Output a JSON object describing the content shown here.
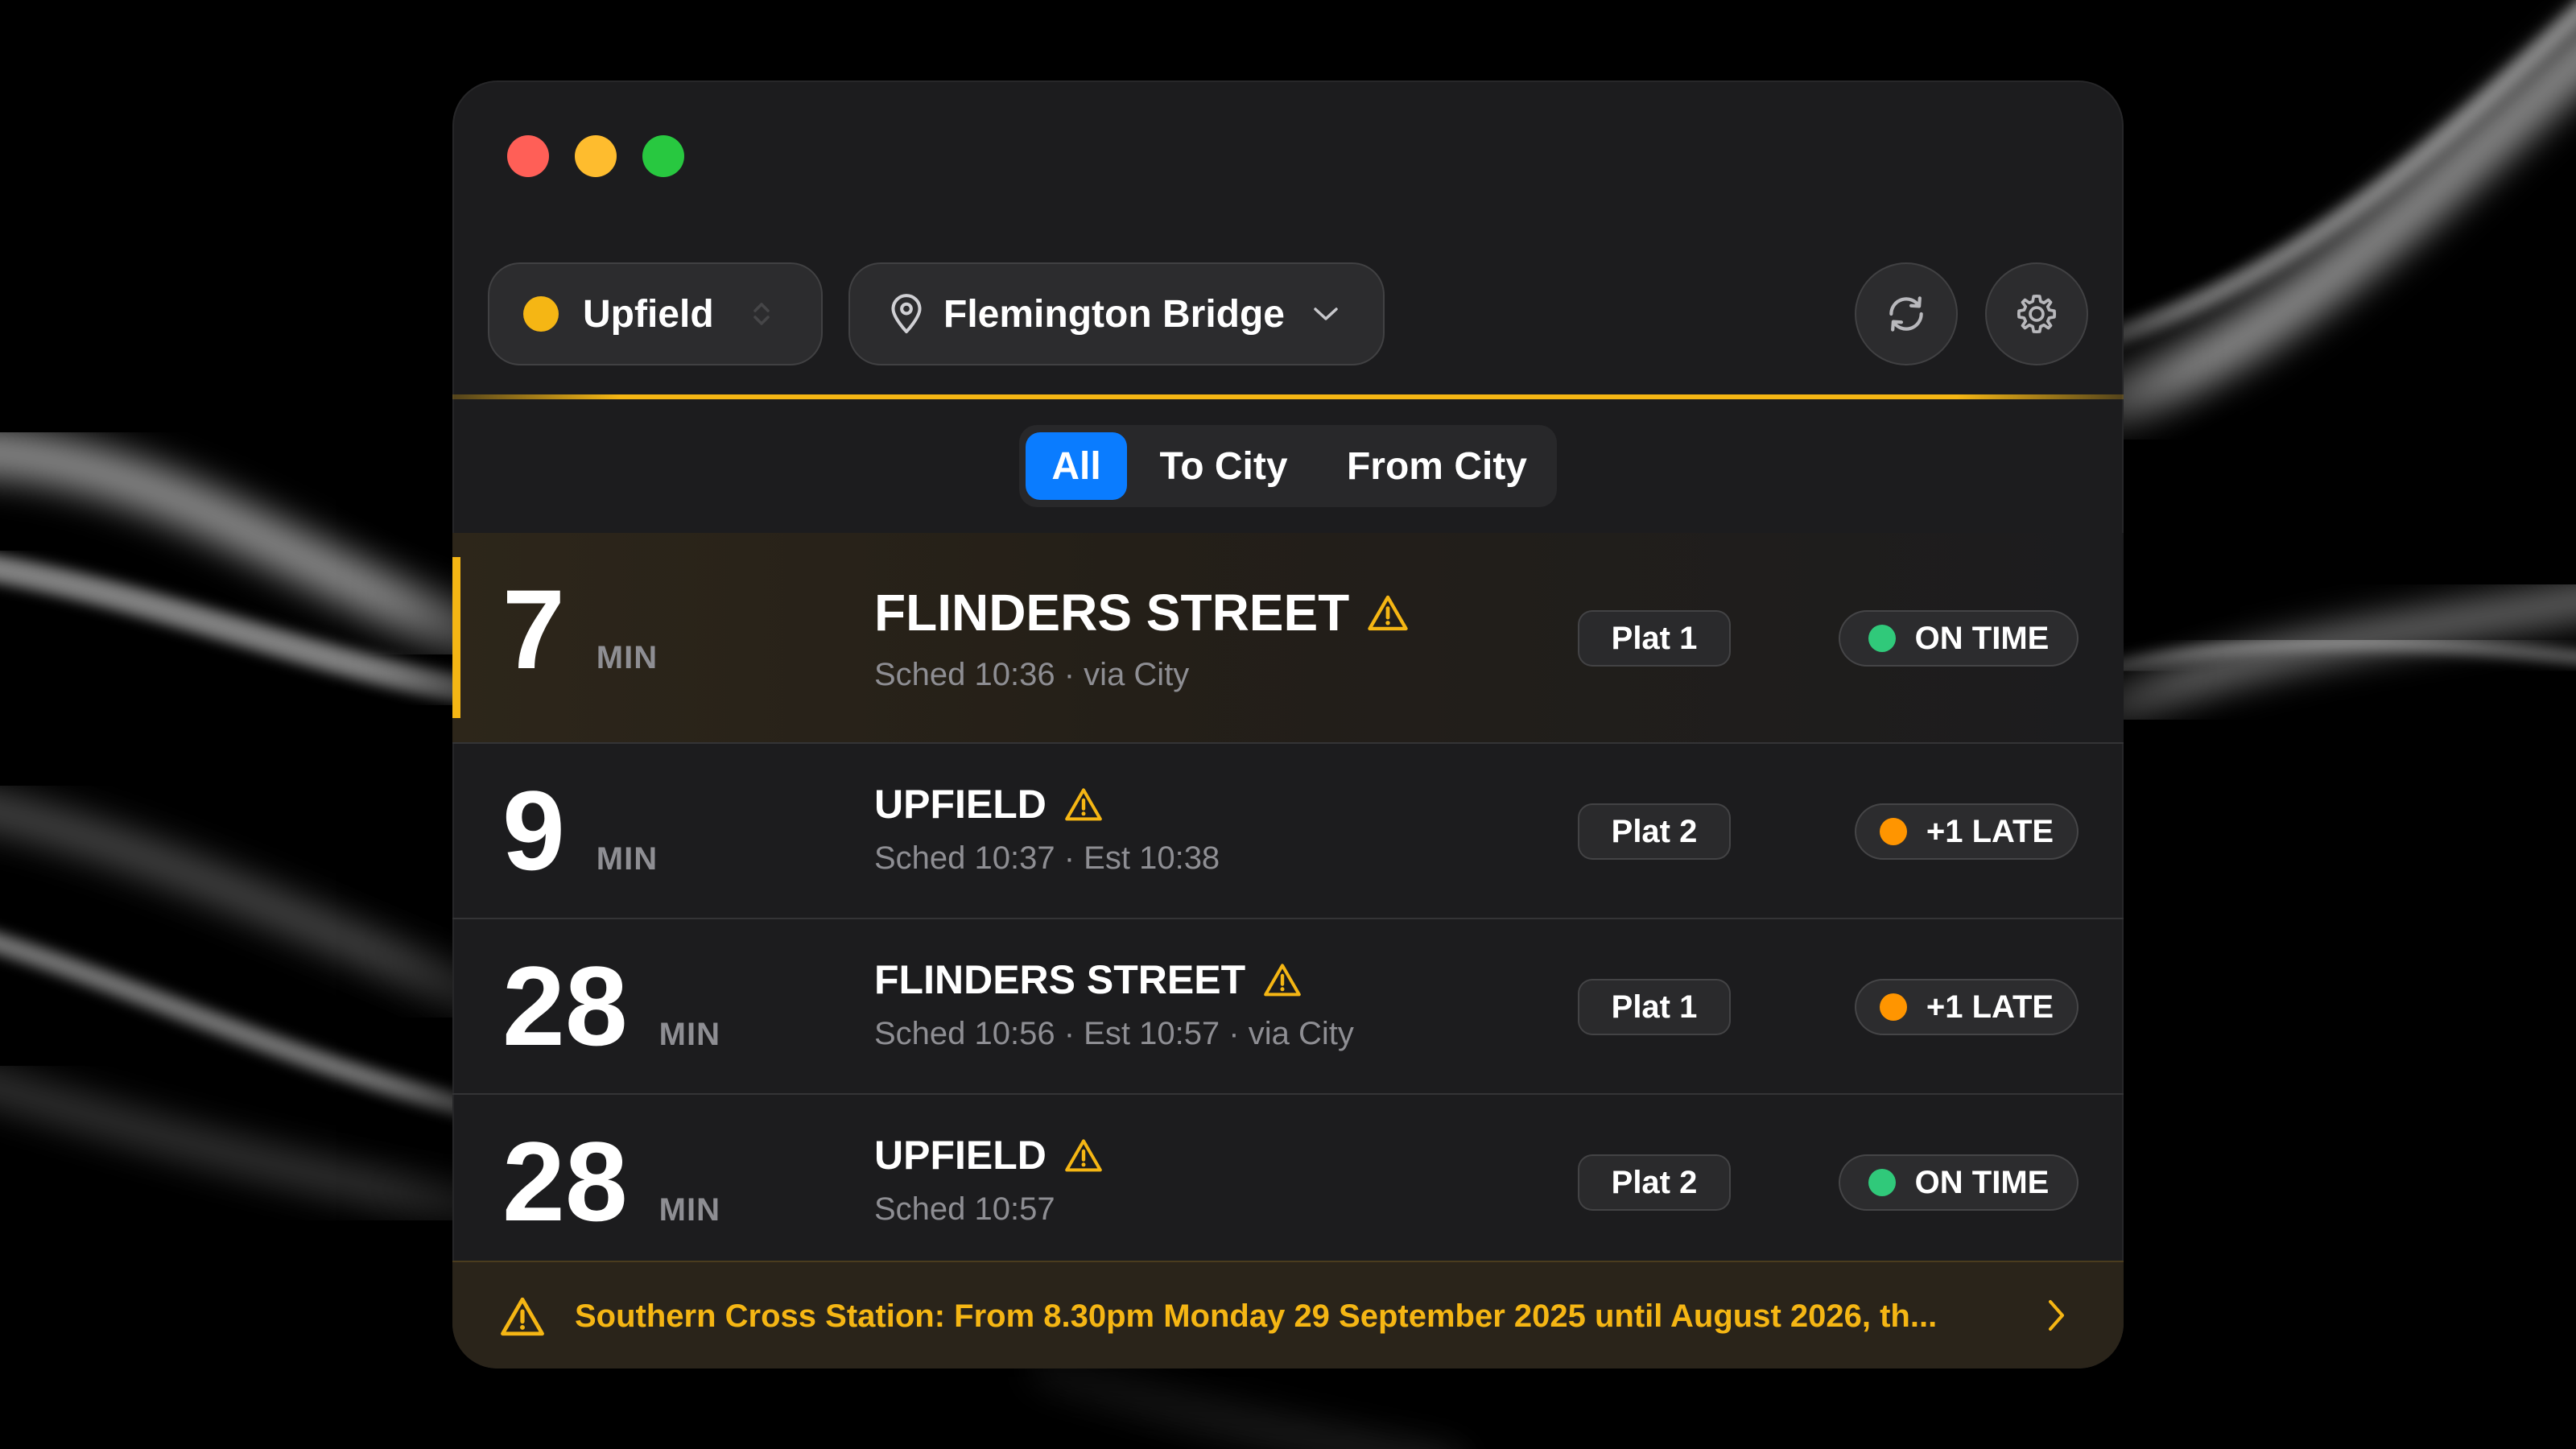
{
  "colors": {
    "line_upfield": "#f5b614",
    "accent": "#f5b614",
    "selected_tab": "#0a7cff",
    "status_on_time": "#30c97a",
    "status_late": "#ff9500",
    "alert_text": "#f5b614"
  },
  "header": {
    "line": {
      "name": "Upfield",
      "icon": "line-color-dot"
    },
    "station": {
      "name": "Flemington Bridge",
      "icon": "location-pin-icon"
    },
    "refresh_icon": "refresh-icon",
    "settings_icon": "gear-icon"
  },
  "filters": {
    "tabs": [
      {
        "label": "All",
        "selected": true
      },
      {
        "label": "To City",
        "selected": false
      },
      {
        "label": "From City",
        "selected": false
      }
    ]
  },
  "departures": [
    {
      "minutes": "7",
      "minutes_unit": "MIN",
      "destination": "FLINDERS STREET",
      "disruption": true,
      "schedule": "Sched 10:36 · via City",
      "platform": "Plat 1",
      "status": "ON TIME",
      "status_kind": "on_time"
    },
    {
      "minutes": "9",
      "minutes_unit": "MIN",
      "destination": "UPFIELD",
      "disruption": true,
      "schedule": "Sched 10:37 · Est 10:38",
      "platform": "Plat 2",
      "status": "+1 LATE",
      "status_kind": "late"
    },
    {
      "minutes": "28",
      "minutes_unit": "MIN",
      "destination": "FLINDERS STREET",
      "disruption": true,
      "schedule": "Sched 10:56 · Est 10:57 · via City",
      "platform": "Plat 1",
      "status": "+1 LATE",
      "status_kind": "late"
    },
    {
      "minutes": "28",
      "minutes_unit": "MIN",
      "destination": "UPFIELD",
      "disruption": true,
      "schedule": "Sched 10:57",
      "platform": "Plat 2",
      "status": "ON TIME",
      "status_kind": "on_time"
    }
  ],
  "alert": {
    "text": "Southern Cross Station: From 8.30pm Monday 29 September 2025 until August 2026, th...",
    "icon": "warning-icon"
  }
}
